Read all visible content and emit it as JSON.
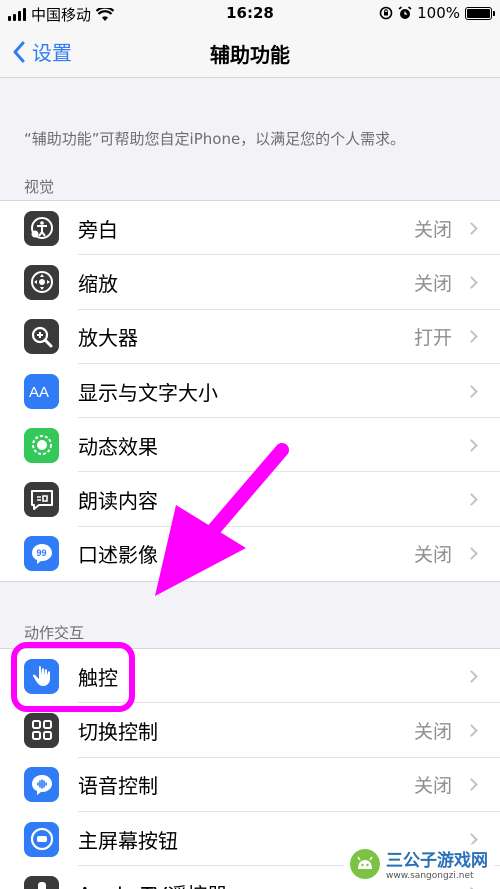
{
  "status_bar": {
    "carrier": "中国移动",
    "time": "16:28",
    "battery": "100%",
    "battery_level": 1.0
  },
  "nav": {
    "back_label": "设置",
    "title": "辅助功能"
  },
  "description": "“辅助功能”可帮助您自定iPhone，以满足您的个人需求。",
  "sections": {
    "vision": {
      "header": "视觉",
      "items": [
        {
          "label": "旁白",
          "value": "关闭",
          "icon": "voiceover-icon"
        },
        {
          "label": "缩放",
          "value": "关闭",
          "icon": "zoom-icon"
        },
        {
          "label": "放大器",
          "value": "打开",
          "icon": "magnifier-icon"
        },
        {
          "label": "显示与文字大小",
          "value": "",
          "icon": "text-size-icon"
        },
        {
          "label": "动态效果",
          "value": "",
          "icon": "motion-icon"
        },
        {
          "label": "朗读内容",
          "value": "",
          "icon": "spoken-content-icon"
        },
        {
          "label": "口述影像",
          "value": "关闭",
          "icon": "audio-description-icon"
        }
      ]
    },
    "interaction": {
      "header": "动作交互",
      "items": [
        {
          "label": "触控",
          "value": "",
          "icon": "touch-icon"
        },
        {
          "label": "切换控制",
          "value": "关闭",
          "icon": "switch-control-icon"
        },
        {
          "label": "语音控制",
          "value": "关闭",
          "icon": "voice-control-icon"
        },
        {
          "label": "主屏幕按钮",
          "value": "",
          "icon": "home-button-icon"
        },
        {
          "label": "Apple TV遥控器",
          "value": "",
          "icon": "apple-tv-remote-icon"
        }
      ]
    }
  },
  "colors": {
    "accent": "#2f7cf6",
    "annotation": "#ff00ff"
  },
  "watermark": {
    "title": "三公子游戏网",
    "url": "www.sangongzi.net"
  }
}
